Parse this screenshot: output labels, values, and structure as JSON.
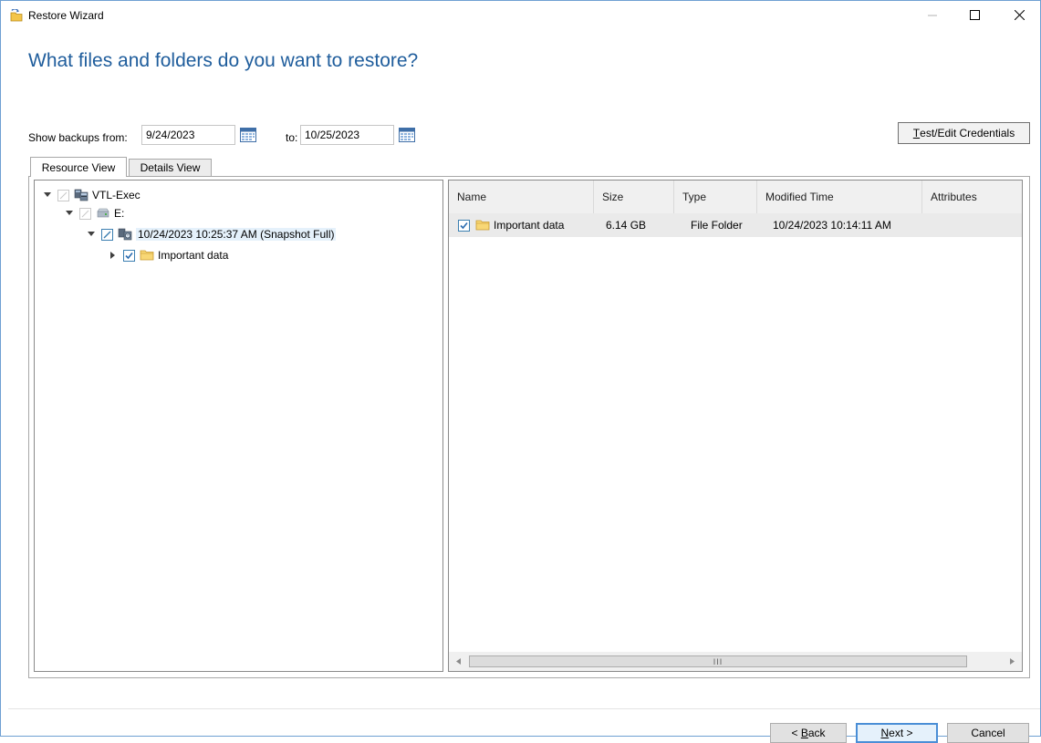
{
  "window": {
    "title": "Restore Wizard",
    "heading": "What files and folders do you want to restore?",
    "controls": [
      "minimize-icon",
      "maximize-icon",
      "close-icon"
    ],
    "accent_color": "#1f5d9c"
  },
  "date_range": {
    "from_label": "Show backups from:",
    "from_value": "9/24/2023",
    "to_label": "to:",
    "to_value": "10/25/2023",
    "calendar_icon": "calendar-icon"
  },
  "credentials_button": {
    "mnemonic": "T",
    "label_rest": "est/Edit Credentials"
  },
  "tabs": [
    {
      "label": "Resource View",
      "active": true
    },
    {
      "label": "Details View",
      "active": false
    }
  ],
  "tree": {
    "nodes": [
      {
        "label": "VTL-Exec",
        "icon": "server-icon",
        "expanded": true,
        "check": "disabled"
      },
      {
        "label": "E:",
        "icon": "drive-icon",
        "expanded": true,
        "check": "disabled"
      },
      {
        "label": "10/24/2023 10:25:37 AM (Snapshot Full)",
        "icon": "snapshot-icon",
        "expanded": true,
        "check": "partial",
        "selected": true
      },
      {
        "label": "Important data",
        "icon": "folder-icon",
        "expanded": false,
        "check": "checked"
      }
    ]
  },
  "file_list": {
    "columns": [
      "Name",
      "Size",
      "Type",
      "Modified Time",
      "Attributes"
    ],
    "rows": [
      {
        "name": "Important data",
        "size": "6.14 GB",
        "type": "File Folder",
        "modified": "10/24/2023 10:14:11 AM",
        "attributes": "",
        "checked": true
      }
    ],
    "scroll_thumb_label": "III"
  },
  "footer": {
    "back_mnemonic": "B",
    "back_prefix": "< ",
    "back_rest": "ack",
    "next_mnemonic": "N",
    "next_rest": "ext >",
    "cancel_label": "Cancel"
  }
}
